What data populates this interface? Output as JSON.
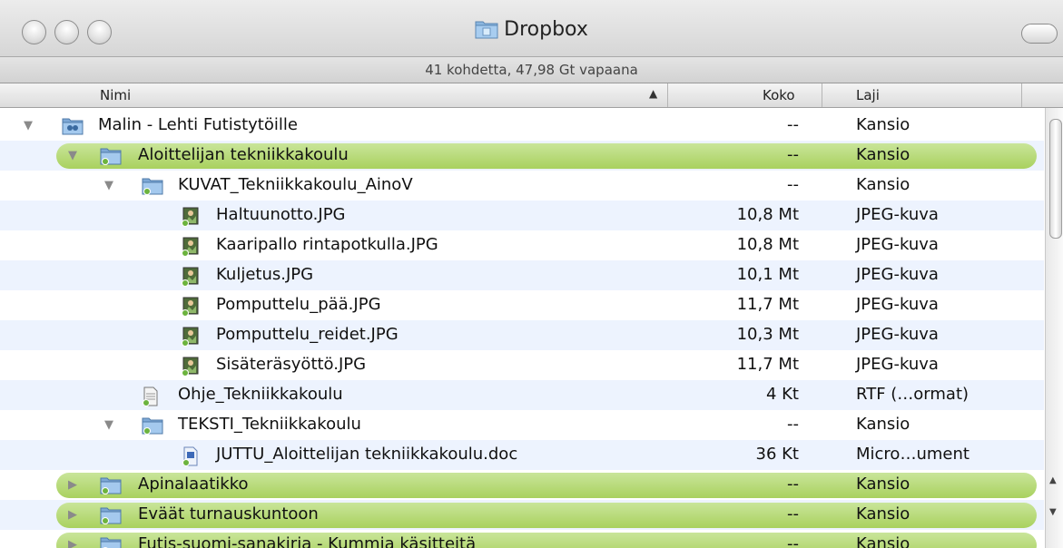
{
  "window": {
    "title": "Dropbox",
    "title_icon": "dropbox-folder-icon",
    "status": "41 kohdetta, 47,98 Gt vapaana"
  },
  "columns": {
    "name": "Nimi",
    "size": "Koko",
    "kind": "Laji",
    "sort_indicator": "▲"
  },
  "rows": [
    {
      "name": "Malin - Lehti Futistytöille",
      "size": "--",
      "kind": "Kansio",
      "icon": "shared-folder-icon",
      "level": 0,
      "disclosure": "open",
      "selected": false
    },
    {
      "name": "Aloittelijan tekniikkakoulu",
      "size": "--",
      "kind": "Kansio",
      "icon": "folder-icon",
      "level": 1,
      "disclosure": "open",
      "selected": true
    },
    {
      "name": "KUVAT_Tekniikkakoulu_AinoV",
      "size": "--",
      "kind": "Kansio",
      "icon": "folder-icon",
      "level": 2,
      "disclosure": "open",
      "selected": false
    },
    {
      "name": "Haltuunotto.JPG",
      "size": "10,8 Mt",
      "kind": "JPEG-kuva",
      "icon": "image-file-icon",
      "level": 3,
      "disclosure": "none",
      "selected": false
    },
    {
      "name": "Kaaripallo rintapotkulla.JPG",
      "size": "10,8 Mt",
      "kind": "JPEG-kuva",
      "icon": "image-file-icon",
      "level": 3,
      "disclosure": "none",
      "selected": false
    },
    {
      "name": "Kuljetus.JPG",
      "size": "10,1 Mt",
      "kind": "JPEG-kuva",
      "icon": "image-file-icon",
      "level": 3,
      "disclosure": "none",
      "selected": false
    },
    {
      "name": "Pomputtelu_pää.JPG",
      "size": "11,7 Mt",
      "kind": "JPEG-kuva",
      "icon": "image-file-icon",
      "level": 3,
      "disclosure": "none",
      "selected": false
    },
    {
      "name": "Pomputtelu_reidet.JPG",
      "size": "10,3 Mt",
      "kind": "JPEG-kuva",
      "icon": "image-file-icon",
      "level": 3,
      "disclosure": "none",
      "selected": false
    },
    {
      "name": "Sisäteräsyöttö.JPG",
      "size": "11,7 Mt",
      "kind": "JPEG-kuva",
      "icon": "image-file-icon",
      "level": 3,
      "disclosure": "none",
      "selected": false
    },
    {
      "name": "Ohje_Tekniikkakoulu",
      "size": "4 Kt",
      "kind": "RTF (…ormat)",
      "icon": "rtf-document-icon",
      "level": 2,
      "disclosure": "none",
      "selected": false
    },
    {
      "name": "TEKSTI_Tekniikkakoulu",
      "size": "--",
      "kind": "Kansio",
      "icon": "folder-icon",
      "level": 2,
      "disclosure": "open",
      "selected": false
    },
    {
      "name": "JUTTU_Aloittelijan tekniikkakoulu.doc",
      "size": "36 Kt",
      "kind": "Micro…ument",
      "icon": "word-document-icon",
      "level": 3,
      "disclosure": "none",
      "selected": false
    },
    {
      "name": "Apinalaatikko",
      "size": "--",
      "kind": "Kansio",
      "icon": "folder-icon",
      "level": 1,
      "disclosure": "closed",
      "selected": true
    },
    {
      "name": "Eväät turnauskuntoon",
      "size": "--",
      "kind": "Kansio",
      "icon": "folder-icon",
      "level": 1,
      "disclosure": "closed",
      "selected": true
    },
    {
      "name": "Futis-suomi-sanakirja - Kummia käsitteitä",
      "size": "--",
      "kind": "Kansio",
      "icon": "folder-icon",
      "level": 1,
      "disclosure": "closed",
      "selected": true
    }
  ],
  "colors": {
    "selection_green": "#a9d15e",
    "alt_row": "#edf3fe"
  }
}
